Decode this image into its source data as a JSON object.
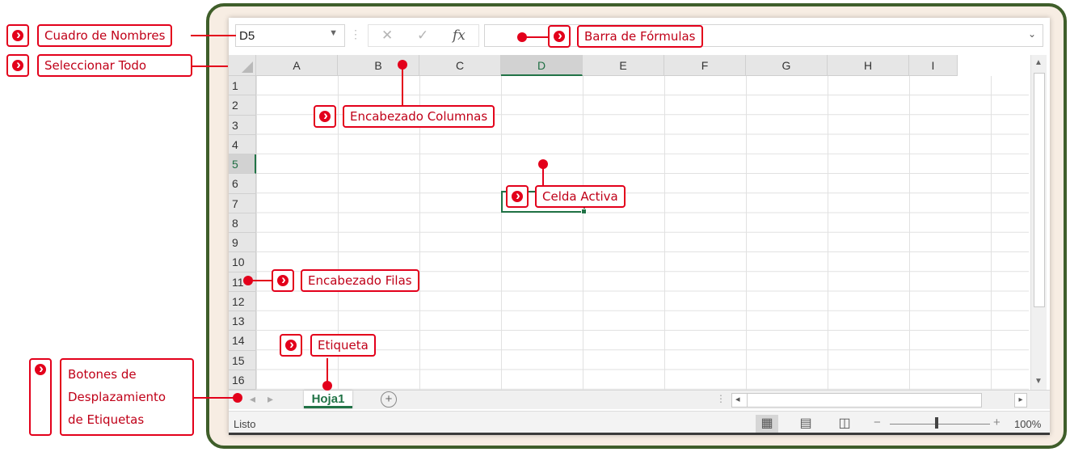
{
  "formula_bar": {
    "name_box_value": "D5",
    "cancel_glyph": "✕",
    "enter_glyph": "✓",
    "fx_label": "fx",
    "formula_value": ""
  },
  "grid": {
    "column_headers": [
      "A",
      "B",
      "C",
      "D",
      "E",
      "F",
      "G",
      "H",
      "I"
    ],
    "row_headers": [
      "1",
      "2",
      "3",
      "4",
      "5",
      "6",
      "7",
      "8",
      "9",
      "10",
      "11",
      "12",
      "13",
      "14",
      "15",
      "16"
    ],
    "active_cell": "D5"
  },
  "sheet_tabs": {
    "tabs": [
      "Hoja1"
    ],
    "add_sheet_glyph": "+"
  },
  "status_bar": {
    "status_text": "Listo",
    "zoom_minus": "−",
    "zoom_plus": "+",
    "zoom_level": "100%"
  },
  "annotations": {
    "name_box": "Cuadro de Nombres",
    "select_all": "Seleccionar Todo",
    "formula_bar": "Barra de Fórmulas",
    "column_headers": "Encabezado Columnas",
    "active_cell": "Celda Activa",
    "row_headers": "Encabezado Filas",
    "sheet_tab": "Etiqueta",
    "tab_scroll_buttons": [
      "Botones de",
      "Desplazamiento",
      "de Etiquetas"
    ]
  },
  "colors": {
    "excel_green": "#217346",
    "annotation_red": "#e3001b",
    "frame_green": "#3f5e2a",
    "frame_fill": "#f7ede3"
  }
}
